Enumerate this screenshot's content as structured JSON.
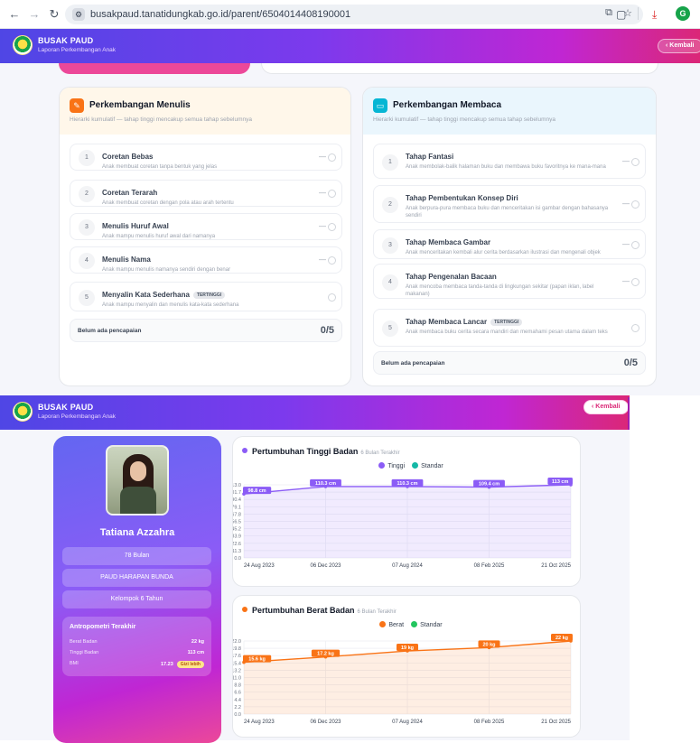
{
  "browser": {
    "url": "busakpaud.tanatidungkab.go.id/parent/6504014408190001",
    "profile_initial": "G"
  },
  "app": {
    "brand": "BUSAK PAUD",
    "subtitle": "Laporan Perkembangan Anak",
    "back_label": "‹  Kembali"
  },
  "writing": {
    "title": "Perkembangan Menulis",
    "subtitle": "Hierarki kumulatif — tahap tinggi mencakup semua tahap sebelumnya",
    "icon": "pencil-icon",
    "accent": "#f97316",
    "items": [
      {
        "num": "1",
        "title": "Coretan Bebas",
        "desc": "Anak membuat coretan tanpa bentuk yang jelas",
        "badge": ""
      },
      {
        "num": "2",
        "title": "Coretan Terarah",
        "desc": "Anak membuat coretan dengan pola atau arah tertentu",
        "badge": ""
      },
      {
        "num": "3",
        "title": "Menulis Huruf Awal",
        "desc": "Anak mampu menulis huruf awal dari namanya",
        "badge": ""
      },
      {
        "num": "4",
        "title": "Menulis Nama",
        "desc": "Anak mampu menulis namanya sendiri dengan benar",
        "badge": ""
      },
      {
        "num": "5",
        "title": "Menyalin Kata Sederhana",
        "desc": "Anak mampu menyalin dan menulis kata-kata sederhana",
        "badge": "TERTINGGI"
      }
    ],
    "summary_label": "Belum ada pencapaian",
    "summary_count": "0/5"
  },
  "reading": {
    "title": "Perkembangan Membaca",
    "subtitle": "Hierarki kumulatif — tahap tinggi mencakup semua tahap sebelumnya",
    "icon": "book-icon",
    "accent": "#06b6d4",
    "items": [
      {
        "num": "1",
        "title": "Tahap Fantasi",
        "desc": "Anak membolak-balik halaman buku dan membawa buku favoritnya ke mana-mana",
        "badge": ""
      },
      {
        "num": "2",
        "title": "Tahap Pembentukan Konsep Diri",
        "desc": "Anak berpura-pura membaca buku dan menceritakan isi gambar dengan bahasanya sendiri",
        "badge": ""
      },
      {
        "num": "3",
        "title": "Tahap Membaca Gambar",
        "desc": "Anak menceritakan kembali alur cerita berdasarkan ilustrasi dan mengenali objek",
        "badge": ""
      },
      {
        "num": "4",
        "title": "Tahap Pengenalan Bacaan",
        "desc": "Anak mencoba membaca tanda-tanda di lingkungan sekitar (papan iklan, label makanan)",
        "badge": ""
      },
      {
        "num": "5",
        "title": "Tahap Membaca Lancar",
        "desc": "Anak membaca buku cerita secara mandiri dan memahami pesan utama dalam teks",
        "badge": "TERTINGGI"
      }
    ],
    "summary_label": "Belum ada pencapaian",
    "summary_count": "0/5"
  },
  "profile": {
    "name": "Tatiana Azzahra",
    "age": "78 Bulan",
    "school": "PAUD HARAPAN BUNDA",
    "group": "Kelompok 6 Tahun",
    "anthro_title": "Antropometri Terakhir",
    "rows": [
      {
        "k": "Berat Badan",
        "v": "22 kg"
      },
      {
        "k": "Tinggi Badan",
        "v": "113 cm"
      },
      {
        "k": "BMI",
        "v": "17.23"
      }
    ],
    "bmi_badge": "Gizi lebih"
  },
  "chart_data": [
    {
      "type": "line",
      "title": "Pertumbuhan Tinggi Badan",
      "subtitle": "6 Bulan Terakhir",
      "accent": "#8b5cf6",
      "legend": [
        {
          "name": "Tinggi",
          "color": "#8b5cf6"
        },
        {
          "name": "Standar",
          "color": "#14b8a6"
        }
      ],
      "categories": [
        "24 Aug 2023",
        "06 Dec 2023",
        "07 Aug 2024",
        "08 Feb 2025",
        "21 Oct 2025"
      ],
      "series": [
        {
          "name": "Tinggi",
          "values": [
            98.8,
            110.3,
            110.3,
            109.4,
            113
          ]
        }
      ],
      "data_labels": [
        "98.8 cm",
        "110.3 cm",
        "110.3 cm",
        "109.4 cm",
        "113 cm"
      ],
      "yticks": [
        "113.0",
        "101.7",
        "90.4",
        "79.1",
        "67.8",
        "56.5",
        "45.2",
        "33.9",
        "22.6",
        "11.3",
        "0.0"
      ],
      "ylim": [
        0,
        113
      ]
    },
    {
      "type": "line",
      "title": "Pertumbuhan Berat Badan",
      "subtitle": "6 Bulan Terakhir",
      "accent": "#f97316",
      "legend": [
        {
          "name": "Berat",
          "color": "#f97316"
        },
        {
          "name": "Standar",
          "color": "#22c55e"
        }
      ],
      "categories": [
        "24 Aug 2023",
        "06 Dec 2023",
        "07 Aug 2024",
        "08 Feb 2025",
        "21 Oct 2025"
      ],
      "series": [
        {
          "name": "Berat",
          "values": [
            15.6,
            17.2,
            19,
            20,
            22
          ]
        }
      ],
      "data_labels": [
        "15.6 kg",
        "17.2 kg",
        "19 kg",
        "20 kg",
        "22 kg"
      ],
      "yticks": [
        "22.0",
        "19.8",
        "17.6",
        "15.4",
        "13.2",
        "11.0",
        "8.8",
        "6.6",
        "4.4",
        "2.2",
        "0.0"
      ],
      "ylim": [
        0,
        22
      ]
    }
  ]
}
